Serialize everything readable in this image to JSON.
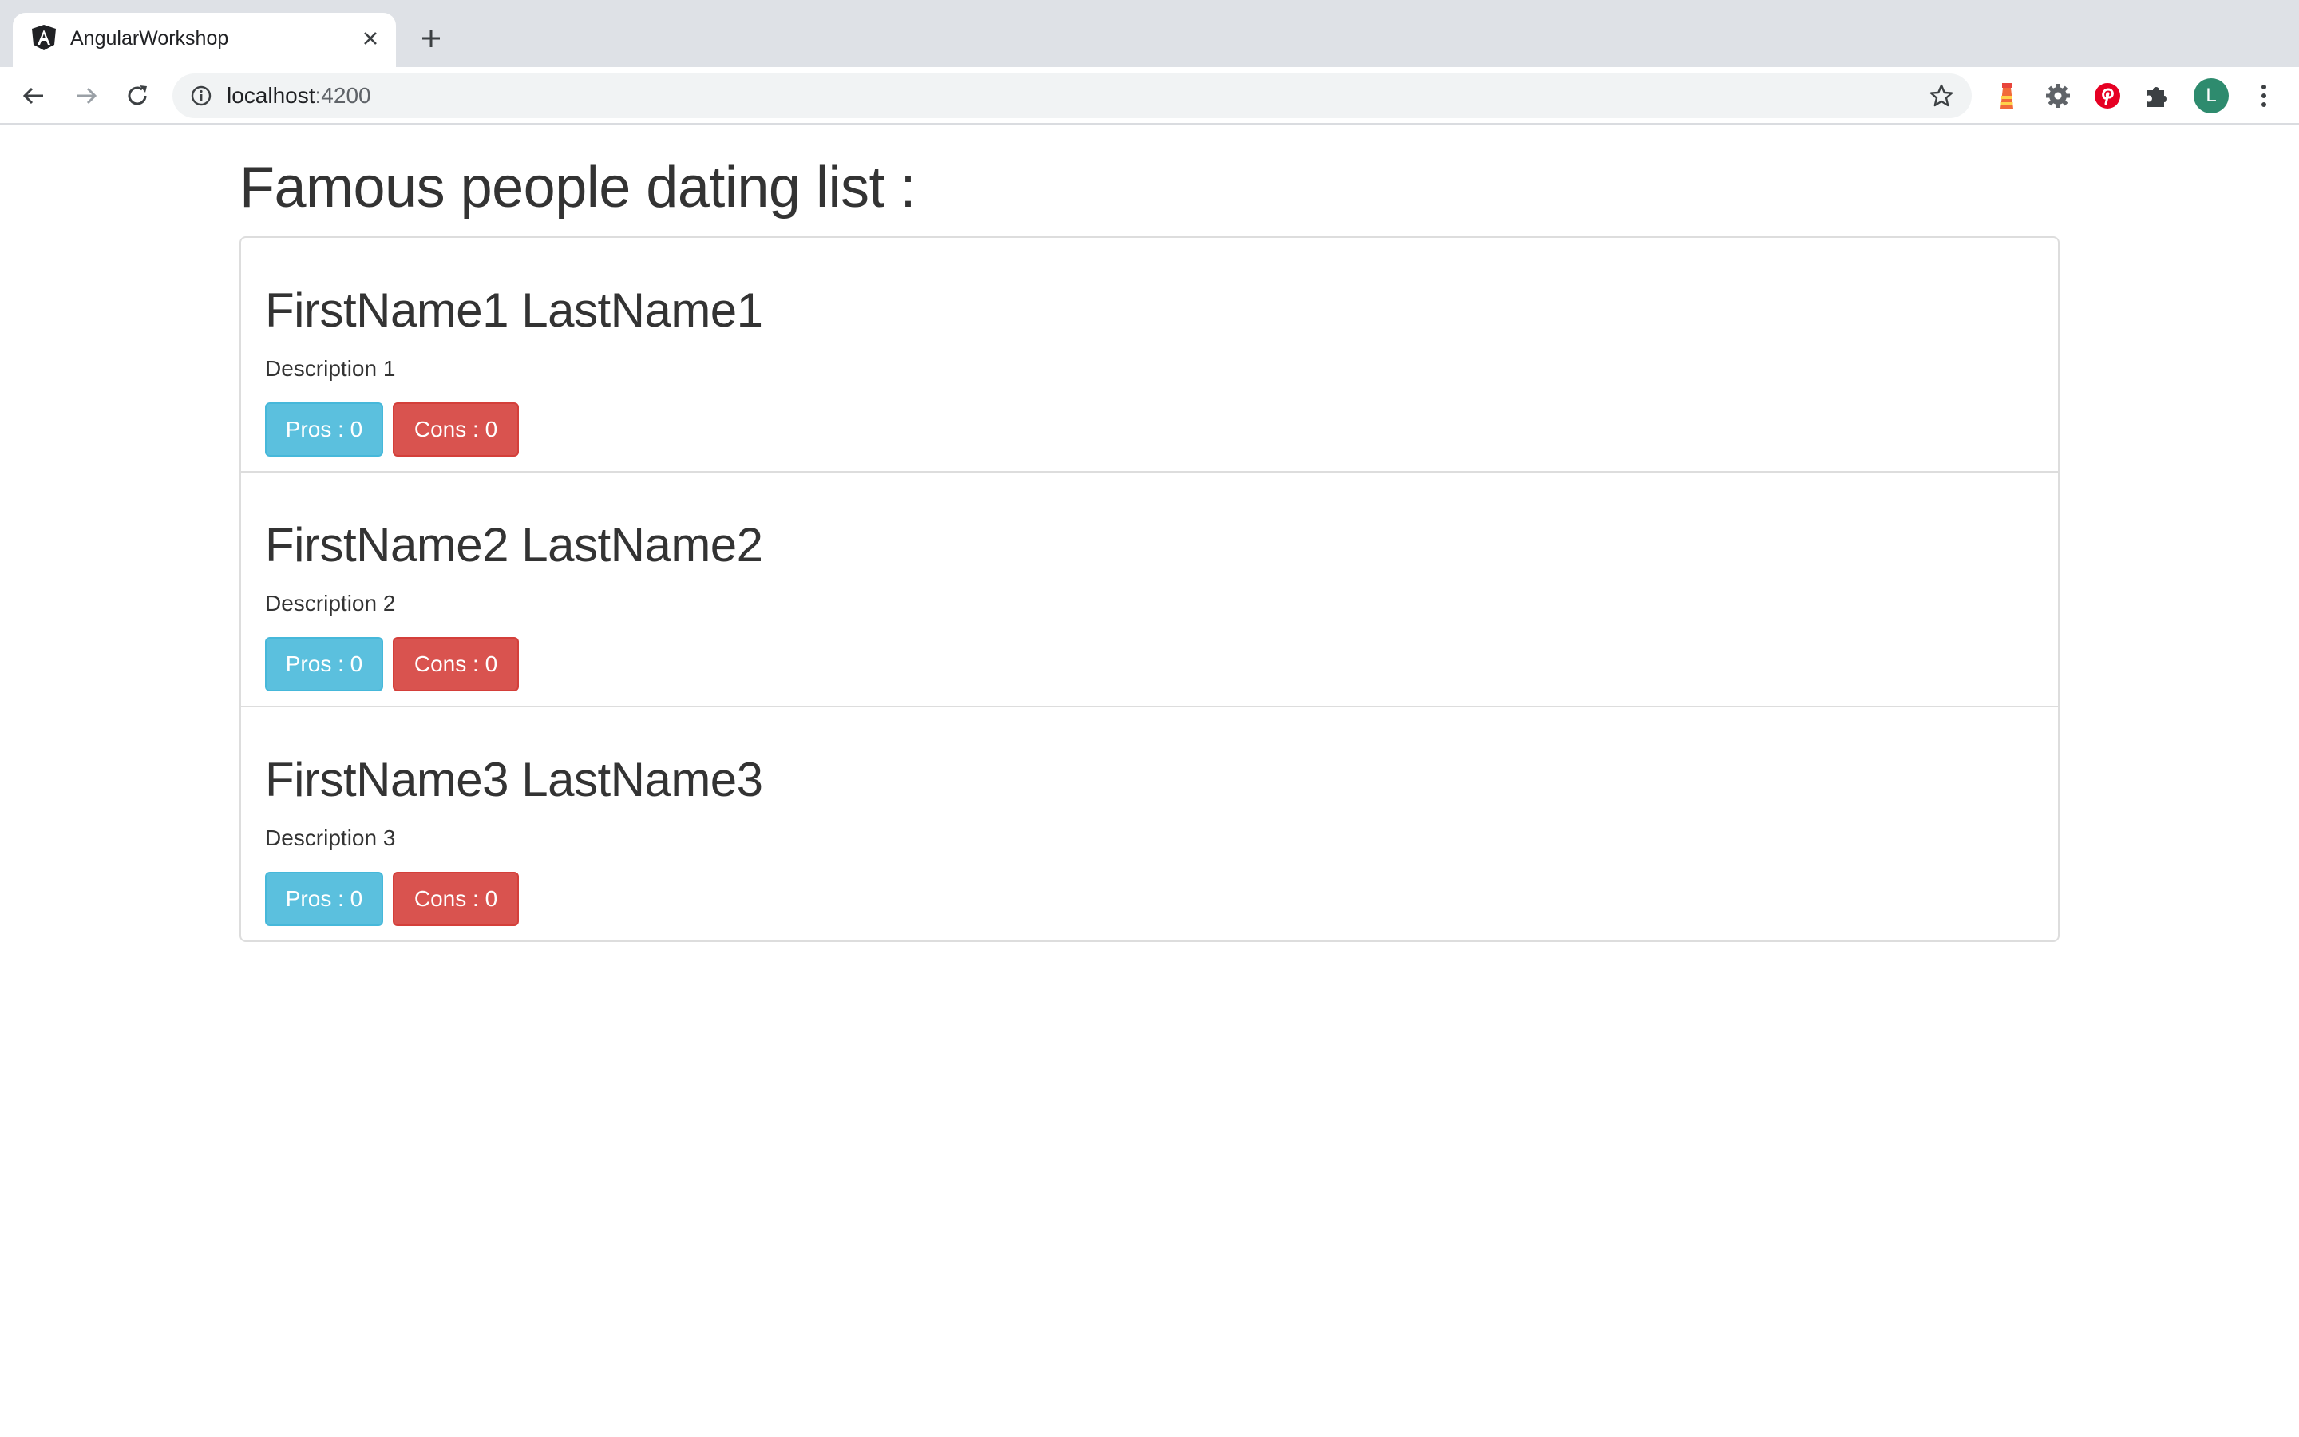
{
  "browser": {
    "tab_title": "AngularWorkshop",
    "url_host": "localhost",
    "url_port": ":4200",
    "icons": [
      "angular-favicon",
      "close-icon",
      "plus-icon",
      "back-arrow-icon",
      "forward-arrow-icon",
      "reload-icon",
      "info-icon",
      "star-icon",
      "lighthouse-icon",
      "gear-icon",
      "pinterest-icon",
      "puzzle-icon",
      "kebab-menu-icon"
    ],
    "avatar_letter": "L"
  },
  "page": {
    "title": "Famous people dating list :",
    "people": [
      {
        "name": "FirstName1 LastName1",
        "description": "Description 1",
        "pros_label": "Pros : 0",
        "cons_label": "Cons : 0"
      },
      {
        "name": "FirstName2 LastName2",
        "description": "Description 2",
        "pros_label": "Pros : 0",
        "cons_label": "Cons : 0"
      },
      {
        "name": "FirstName3 LastName3",
        "description": "Description 3",
        "pros_label": "Pros : 0",
        "cons_label": "Cons : 0"
      }
    ]
  },
  "colors": {
    "pros": "#5bc0de",
    "cons": "#d9534f",
    "avatar": "#2e8b6e"
  }
}
